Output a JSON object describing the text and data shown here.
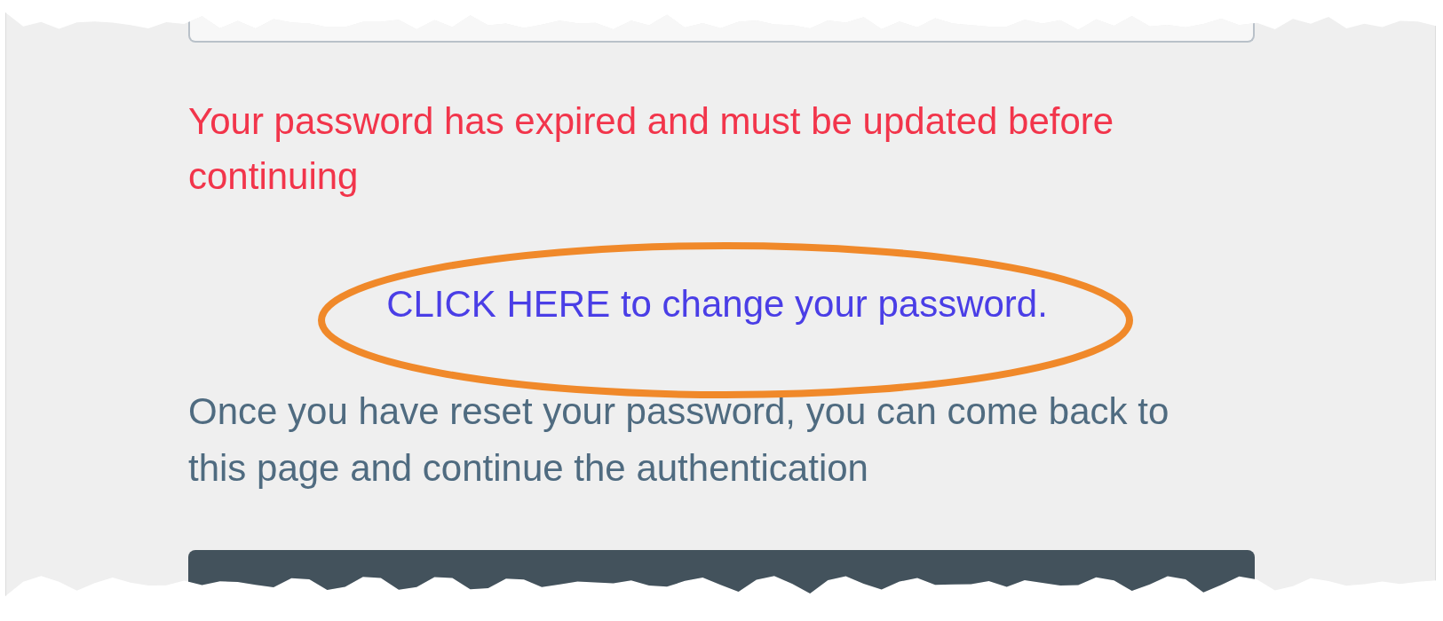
{
  "error_message": "Your password has expired and must be updated before continuing",
  "change_password_link": "CLICK HERE to change your password.",
  "info_message": "Once you have reset your password, you can come back to this page and continue the authentication"
}
